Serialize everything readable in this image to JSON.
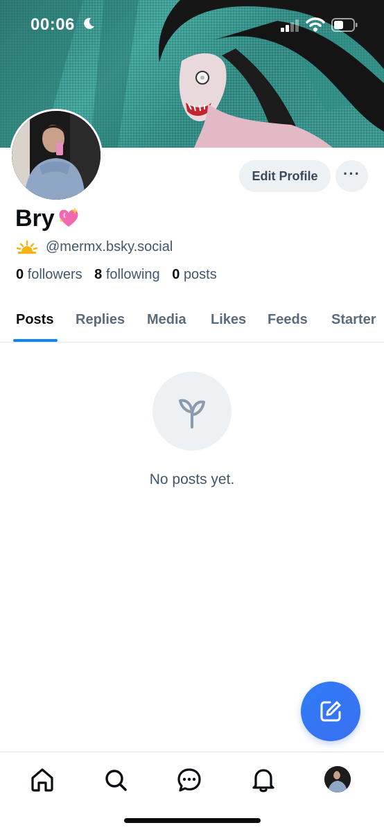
{
  "status_bar": {
    "time": "00:06",
    "icons": [
      "moon-icon",
      "cellular-signal-icon",
      "wifi-icon",
      "battery-icon"
    ]
  },
  "profile": {
    "display_name": "Bry",
    "name_emoji": "sparkling-heart-emoji",
    "handle_emoji": "sunrise-emoji",
    "handle": "@mermx.bsky.social",
    "followers_count": "0",
    "followers_label": "followers",
    "following_count": "8",
    "following_label": "following",
    "posts_count": "0",
    "posts_label": "posts"
  },
  "actions": {
    "edit_profile": "Edit Profile",
    "more": "···"
  },
  "tabs": [
    {
      "label": "Posts",
      "active": true
    },
    {
      "label": "Replies",
      "active": false
    },
    {
      "label": "Media",
      "active": false
    },
    {
      "label": "Likes",
      "active": false
    },
    {
      "label": "Feeds",
      "active": false
    },
    {
      "label": "Starter",
      "active": false
    }
  ],
  "empty_state": {
    "icon": "sprout-icon",
    "message": "No posts yet."
  },
  "fab": {
    "icon": "compose-icon"
  },
  "bottom_nav": {
    "items": [
      "home-icon",
      "search-icon",
      "chat-icon",
      "bell-icon",
      "profile-avatar"
    ]
  },
  "colors": {
    "accent": "#1083fe",
    "fab": "#3273f6",
    "muted_text": "#42576c",
    "button_bg": "#eef1f4"
  }
}
